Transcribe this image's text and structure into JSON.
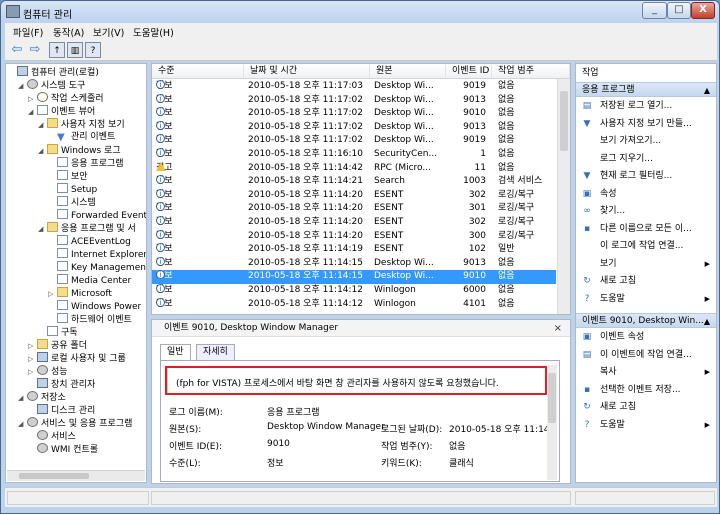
{
  "window": {
    "title": "컴퓨터 관리",
    "min": "_",
    "max": "□",
    "close": "X"
  },
  "menu": [
    "파일(F)",
    "동작(A)",
    "보기(V)",
    "도움말(H)"
  ],
  "toolbar": {
    "back": "⇦",
    "forward": "⇨",
    "up": "↑",
    "show": "▥",
    "help": "?"
  },
  "tree": [
    {
      "label": "컴퓨터 관리(로컬)",
      "depth": 0,
      "toggle": "",
      "icon": "pc-icon",
      "cls": "pc"
    },
    {
      "label": "시스템 도구",
      "depth": 1,
      "toggle": "◢",
      "icon": "tools-icon",
      "cls": "gear"
    },
    {
      "label": "작업 스케줄러",
      "depth": 2,
      "toggle": "▷",
      "icon": "clock-icon",
      "cls": "clock"
    },
    {
      "label": "이벤트 뷰어",
      "depth": 2,
      "toggle": "◢",
      "icon": "event-viewer-icon",
      "cls": "log"
    },
    {
      "label": "사용자 지정 보기",
      "depth": 3,
      "toggle": "◢",
      "icon": "folder-icon",
      "cls": "folder"
    },
    {
      "label": "관리 이벤트",
      "depth": 4,
      "toggle": "",
      "icon": "filter-icon",
      "cls": "filter"
    },
    {
      "label": "Windows 로그",
      "depth": 3,
      "toggle": "◢",
      "icon": "folder-icon",
      "cls": "folder"
    },
    {
      "label": "응용 프로그램",
      "depth": 4,
      "toggle": "",
      "icon": "log-icon",
      "cls": "log"
    },
    {
      "label": "보안",
      "depth": 4,
      "toggle": "",
      "icon": "log-icon",
      "cls": "log"
    },
    {
      "label": "Setup",
      "depth": 4,
      "toggle": "",
      "icon": "log-icon",
      "cls": "log"
    },
    {
      "label": "시스템",
      "depth": 4,
      "toggle": "",
      "icon": "log-icon",
      "cls": "log"
    },
    {
      "label": "Forwarded Event",
      "depth": 4,
      "toggle": "",
      "icon": "log-icon",
      "cls": "log"
    },
    {
      "label": "응용 프로그램 및 서",
      "depth": 3,
      "toggle": "◢",
      "icon": "folder-icon",
      "cls": "folder"
    },
    {
      "label": "ACEEventLog",
      "depth": 4,
      "toggle": "",
      "icon": "log-icon",
      "cls": "log"
    },
    {
      "label": "Internet Explorer",
      "depth": 4,
      "toggle": "",
      "icon": "log-icon",
      "cls": "log"
    },
    {
      "label": "Key Management",
      "depth": 4,
      "toggle": "",
      "icon": "log-icon",
      "cls": "log"
    },
    {
      "label": "Media Center",
      "depth": 4,
      "toggle": "",
      "icon": "log-icon",
      "cls": "log"
    },
    {
      "label": "Microsoft",
      "depth": 4,
      "toggle": "▷",
      "icon": "folder-icon",
      "cls": "folder"
    },
    {
      "label": "Windows Power",
      "depth": 4,
      "toggle": "",
      "icon": "log-icon",
      "cls": "log"
    },
    {
      "label": "하드웨어 이벤트",
      "depth": 4,
      "toggle": "",
      "icon": "log-icon",
      "cls": "log"
    },
    {
      "label": "구독",
      "depth": 3,
      "toggle": "",
      "icon": "subscription-icon",
      "cls": "log"
    },
    {
      "label": "공유 폴더",
      "depth": 2,
      "toggle": "▷",
      "icon": "shared-folder-icon",
      "cls": "folder"
    },
    {
      "label": "로컬 사용자 및 그룹",
      "depth": 2,
      "toggle": "▷",
      "icon": "users-icon",
      "cls": "pc"
    },
    {
      "label": "성능",
      "depth": 2,
      "toggle": "▷",
      "icon": "performance-icon",
      "cls": "gear"
    },
    {
      "label": "장치 관리자",
      "depth": 2,
      "toggle": "",
      "icon": "device-manager-icon",
      "cls": "pc"
    },
    {
      "label": "저장소",
      "depth": 1,
      "toggle": "◢",
      "icon": "storage-icon",
      "cls": "gear"
    },
    {
      "label": "디스크 관리",
      "depth": 2,
      "toggle": "",
      "icon": "disk-icon",
      "cls": "pc"
    },
    {
      "label": "서비스 및 응용 프로그램",
      "depth": 1,
      "toggle": "◢",
      "icon": "services-app-icon",
      "cls": "gear"
    },
    {
      "label": "서비스",
      "depth": 2,
      "toggle": "",
      "icon": "services-icon",
      "cls": "gear"
    },
    {
      "label": "WMI 컨트롤",
      "depth": 2,
      "toggle": "",
      "icon": "wmi-icon",
      "cls": "gear"
    }
  ],
  "columns": [
    "수준",
    "날짜 및 시간",
    "원본",
    "이벤트 ID",
    "작업 범주"
  ],
  "events": [
    {
      "level": "정보",
      "type": "info",
      "date": "2010-05-18 오후 11:17:03",
      "source": "Desktop Wi...",
      "id": "9019",
      "cat": "없음"
    },
    {
      "level": "정보",
      "type": "info",
      "date": "2010-05-18 오후 11:17:02",
      "source": "Desktop Wi...",
      "id": "9013",
      "cat": "없음"
    },
    {
      "level": "정보",
      "type": "info",
      "date": "2010-05-18 오후 11:17:02",
      "source": "Desktop Wi...",
      "id": "9010",
      "cat": "없음"
    },
    {
      "level": "정보",
      "type": "info",
      "date": "2010-05-18 오후 11:17:02",
      "source": "Desktop Wi...",
      "id": "9013",
      "cat": "없음"
    },
    {
      "level": "정보",
      "type": "info",
      "date": "2010-05-18 오후 11:17:02",
      "source": "Desktop Wi...",
      "id": "9019",
      "cat": "없음"
    },
    {
      "level": "정보",
      "type": "info",
      "date": "2010-05-18 오후 11:16:10",
      "source": "SecurityCen...",
      "id": "1",
      "cat": "없음"
    },
    {
      "level": "경고",
      "type": "warn",
      "date": "2010-05-18 오후 11:14:42",
      "source": "RPC (Micro...",
      "id": "11",
      "cat": "없음"
    },
    {
      "level": "정보",
      "type": "info",
      "date": "2010-05-18 오후 11:14:21",
      "source": "Search",
      "id": "1003",
      "cat": "검색 서비스"
    },
    {
      "level": "정보",
      "type": "info",
      "date": "2010-05-18 오후 11:14:20",
      "source": "ESENT",
      "id": "302",
      "cat": "로깅/복구"
    },
    {
      "level": "정보",
      "type": "info",
      "date": "2010-05-18 오후 11:14:20",
      "source": "ESENT",
      "id": "301",
      "cat": "로깅/복구"
    },
    {
      "level": "정보",
      "type": "info",
      "date": "2010-05-18 오후 11:14:20",
      "source": "ESENT",
      "id": "302",
      "cat": "로깅/복구"
    },
    {
      "level": "정보",
      "type": "info",
      "date": "2010-05-18 오후 11:14:20",
      "source": "ESENT",
      "id": "300",
      "cat": "로깅/복구"
    },
    {
      "level": "정보",
      "type": "info",
      "date": "2010-05-18 오후 11:14:19",
      "source": "ESENT",
      "id": "102",
      "cat": "일반"
    },
    {
      "level": "정보",
      "type": "info",
      "date": "2010-05-18 오후 11:14:15",
      "source": "Desktop Wi...",
      "id": "9013",
      "cat": "없음"
    },
    {
      "level": "정보",
      "type": "info",
      "date": "2010-05-18 오후 11:14:15",
      "source": "Desktop Wi...",
      "id": "9010",
      "cat": "없음",
      "selected": true
    },
    {
      "level": "정보",
      "type": "info",
      "date": "2010-05-18 오후 11:14:12",
      "source": "Winlogon",
      "id": "6000",
      "cat": "없음"
    },
    {
      "level": "정보",
      "type": "info",
      "date": "2010-05-18 오후 11:14:12",
      "source": "Winlogon",
      "id": "4101",
      "cat": "없음"
    }
  ],
  "detail": {
    "title": "이벤트 9010, Desktop Window Manager",
    "close": "×",
    "tab_general": "일반",
    "tab_detail": "자세히",
    "message": "(fph for VISTA) 프로세스에서 바탕 화면 창 관리자를 사용하지 않도록 요청했습니다.",
    "log_name_label": "로그 이름(M):",
    "log_name": "응용 프로그램",
    "source_label": "원본(S):",
    "source": "Desktop Window Manager",
    "logged_label": "로그된 날짜(D):",
    "logged": "2010-05-18 오후 11:14:15",
    "event_id_label": "이벤트 ID(E):",
    "event_id": "9010",
    "category_label": "작업 범주(Y):",
    "category": "없음",
    "level_label": "수준(L):",
    "level": "정보",
    "keywords_label": "키워드(K):",
    "keywords": "클래식"
  },
  "actions": {
    "header": "작업",
    "section1": "응용 프로그램",
    "items1": [
      {
        "label": "저장된 로그 열기...",
        "icon": "open-log-icon",
        "glyph": "▤"
      },
      {
        "label": "사용자 지정 보기 만들...",
        "icon": "create-view-icon",
        "glyph": "▼"
      },
      {
        "label": "보기 가져오기...",
        "icon": "",
        "glyph": ""
      },
      {
        "label": "로그 지우기...",
        "icon": "",
        "glyph": ""
      },
      {
        "label": "현재 로그 필터링...",
        "icon": "filter-icon",
        "glyph": "▼"
      },
      {
        "label": "속성",
        "icon": "properties-icon",
        "glyph": "▣"
      },
      {
        "label": "찾기...",
        "icon": "binoculars-icon",
        "glyph": "∞"
      },
      {
        "label": "다른 이름으로 모든 이...",
        "icon": "save-icon",
        "glyph": "▪"
      },
      {
        "label": "이 로그에 작업 연결...",
        "icon": "",
        "glyph": ""
      },
      {
        "label": "보기",
        "icon": "",
        "glyph": "",
        "sub": "▶"
      },
      {
        "label": "새로 고침",
        "icon": "refresh-icon",
        "glyph": "↻"
      },
      {
        "label": "도움말",
        "icon": "help-icon",
        "glyph": "?",
        "sub": "▶"
      }
    ],
    "section2": "이벤트 9010, Desktop Win...",
    "items2": [
      {
        "label": "이벤트 속성",
        "icon": "event-properties-icon",
        "glyph": "▣"
      },
      {
        "label": "이 이벤트에 작업 연결...",
        "icon": "attach-task-icon",
        "glyph": "▤"
      },
      {
        "label": "복사",
        "icon": "",
        "glyph": "",
        "sub": "▶"
      },
      {
        "label": "선택한 이벤트 저장...",
        "icon": "save-icon",
        "glyph": "▪"
      },
      {
        "label": "새로 고침",
        "icon": "refresh-icon",
        "glyph": "↻"
      },
      {
        "label": "도움말",
        "icon": "help-icon",
        "glyph": "?",
        "sub": "▶"
      }
    ],
    "chevron": "▲"
  }
}
